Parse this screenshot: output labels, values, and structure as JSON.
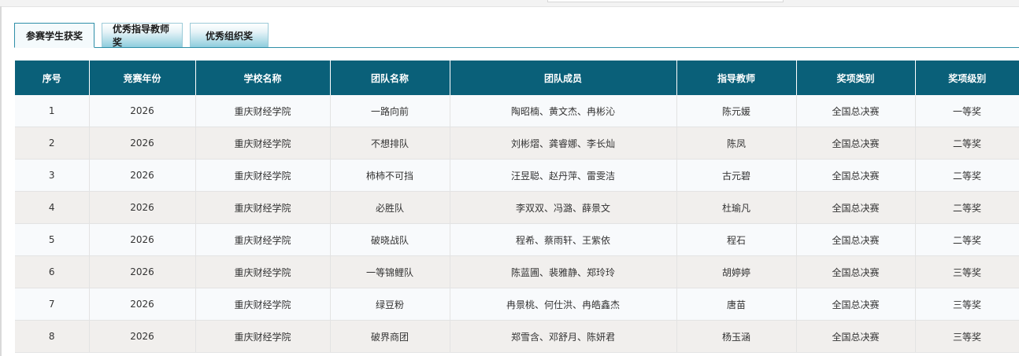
{
  "tabs": [
    {
      "label": "参赛学生获奖",
      "active": true
    },
    {
      "label": "优秀指导教师奖",
      "active": false
    },
    {
      "label": "优秀组织奖",
      "active": false
    }
  ],
  "table": {
    "headers": [
      "序号",
      "竞赛年份",
      "学校名称",
      "团队名称",
      "团队成员",
      "指导教师",
      "奖项类别",
      "奖项级别"
    ],
    "rows": [
      [
        "1",
        "2026",
        "重庆财经学院",
        "一路向前",
        "陶昭楠、黄文杰、冉彬沁",
        "陈元媛",
        "全国总决赛",
        "一等奖"
      ],
      [
        "2",
        "2026",
        "重庆财经学院",
        "不想排队",
        "刘彬熠、龚睿娜、李长灿",
        "陈凤",
        "全国总决赛",
        "二等奖"
      ],
      [
        "3",
        "2026",
        "重庆财经学院",
        "柿柿不可挡",
        "汪昱聪、赵丹萍、雷雯洁",
        "古元碧",
        "全国总决赛",
        "二等奖"
      ],
      [
        "4",
        "2026",
        "重庆财经学院",
        "必胜队",
        "李双双、冯潞、薛景文",
        "杜瑜凡",
        "全国总决赛",
        "二等奖"
      ],
      [
        "5",
        "2026",
        "重庆财经学院",
        "破晓战队",
        "程希、蔡雨轩、王紫依",
        "程石",
        "全国总决赛",
        "二等奖"
      ],
      [
        "6",
        "2026",
        "重庆财经学院",
        "一等锦鲤队",
        "陈蓝圃、裴雅静、郑玲玲",
        "胡婷婷",
        "全国总决赛",
        "三等奖"
      ],
      [
        "7",
        "2026",
        "重庆财经学院",
        "绿豆粉",
        "冉景桃、何仕洪、冉皓鑫杰",
        "唐苗",
        "全国总决赛",
        "三等奖"
      ],
      [
        "8",
        "2026",
        "重庆财经学院",
        "破界商团",
        "郑雪含、邓舒月、陈妍君",
        "杨玉涵",
        "全国总决赛",
        "三等奖"
      ]
    ]
  }
}
